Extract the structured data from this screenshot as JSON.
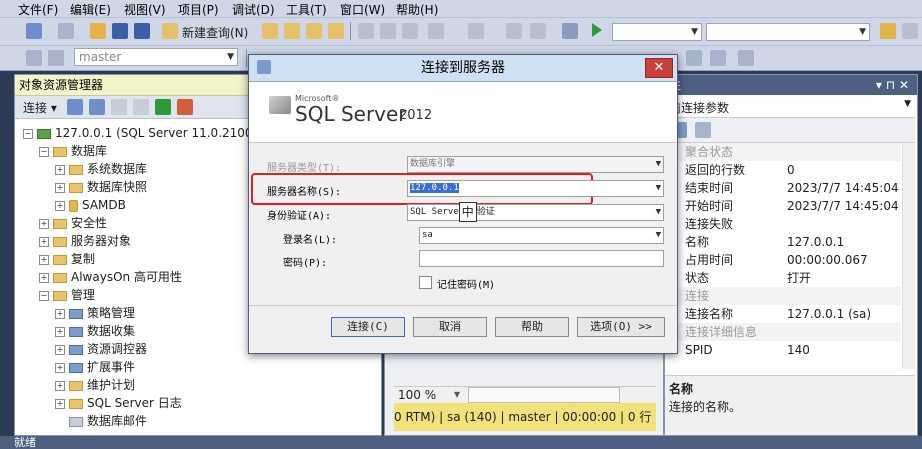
{
  "menu": [
    "文件(F)",
    "编辑(E)",
    "视图(V)",
    "项目(P)",
    "调试(D)",
    "工具(T)",
    "窗口(W)",
    "帮助(H)"
  ],
  "toolbar": {
    "new_query_label": "新建查询(N)",
    "database_combo": "master"
  },
  "object_explorer": {
    "title": "对象资源管理器",
    "connect_label": "连接",
    "server_node": "127.0.0.1 (SQL Server 11.0.2100 -",
    "nodes": {
      "databases": "数据库",
      "system_databases": "系统数据库",
      "db_snapshots": "数据库快照",
      "samdb": "SAMDB",
      "security": "安全性",
      "server_objects": "服务器对象",
      "replication": "复制",
      "alwayson": "AlwaysOn 高可用性",
      "management": "管理",
      "policy_management": "策略管理",
      "data_collection": "数据收集",
      "resource_governor": "资源调控器",
      "extended_events": "扩展事件",
      "maintenance_plans": "维护计划",
      "sql_server_logs": "SQL Server 日志",
      "database_mail": "数据库邮件"
    }
  },
  "query_area": {
    "zoom": "100 %",
    "status_items": [
      "0 RTM)",
      "sa (140)",
      "master",
      "00:00:00",
      "0 行"
    ]
  },
  "properties": {
    "title": "性",
    "combo": "前连接参数",
    "rows": [
      {
        "k": "聚合状态",
        "v": "",
        "cat": true
      },
      {
        "k": "返回的行数",
        "v": "0"
      },
      {
        "k": "结束时间",
        "v": "2023/7/7 14:45:04"
      },
      {
        "k": "开始时间",
        "v": "2023/7/7 14:45:04"
      },
      {
        "k": "连接失败",
        "v": ""
      },
      {
        "k": "名称",
        "v": "127.0.0.1"
      },
      {
        "k": "占用时间",
        "v": "00:00:00.067"
      },
      {
        "k": "状态",
        "v": "打开"
      },
      {
        "k": "连接",
        "v": "",
        "cat": true
      },
      {
        "k": "连接名称",
        "v": "127.0.0.1 (sa)"
      },
      {
        "k": "连接详细信息",
        "v": "",
        "cat": true
      },
      {
        "k": "SPID",
        "v": "140"
      }
    ],
    "desc_title": "名称",
    "desc_text": "连接的名称。"
  },
  "dialog": {
    "title": "连接到服务器",
    "brand_small": "Microsoft®",
    "brand": "SQL Server",
    "brand_version": "2012",
    "server_type_label": "服务器类型(T):",
    "server_type_value": "数据库引擎",
    "server_name_label": "服务器名称(S):",
    "server_name_value": "127.0.0.1",
    "auth_label": "身份验证(A):",
    "auth_value_a": "SQL Serve",
    "ime_char": "中",
    "auth_value_b": "验证",
    "login_label": "登录名(L):",
    "login_value": "sa",
    "password_label": "密码(P):",
    "remember_label": "记住密码(M)",
    "buttons": {
      "connect": "连接(C)",
      "cancel": "取消",
      "help": "帮助",
      "options": "选项(O) >>"
    }
  },
  "statusbar": "就绪",
  "colors": {
    "highlight_border": "#e02020",
    "selection": "#3b6bd6"
  }
}
